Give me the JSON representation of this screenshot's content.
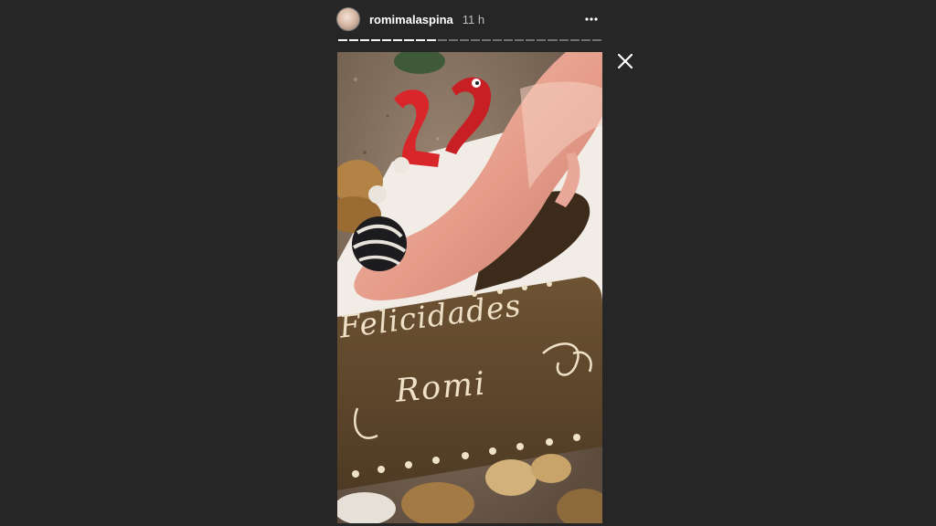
{
  "story": {
    "username": "romimalaspina",
    "time_ago": "11 h",
    "segments_total": 24,
    "segments_viewed": 9,
    "media": {
      "cake_line1": "Felicidades",
      "cake_line2": "Romi"
    }
  },
  "icons": {
    "more": "more-horizontal-icon",
    "close": "close-icon"
  },
  "colors": {
    "background": "#262626",
    "text": "#ffffff",
    "muted_text": "#bdbdbd"
  }
}
